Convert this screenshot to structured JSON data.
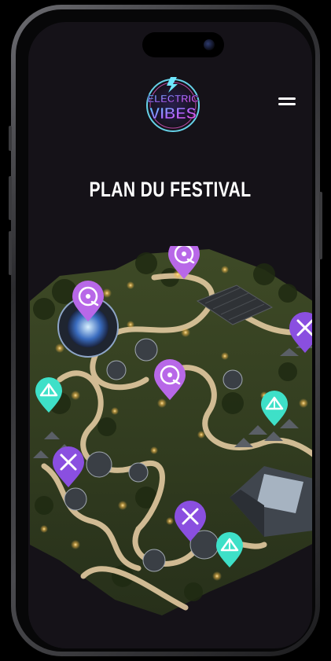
{
  "app": {
    "logo_line1": "ELECTRIC",
    "logo_line2": "VIBES"
  },
  "header": {
    "menu_icon": "hamburger-icon"
  },
  "page": {
    "title": "PLAN DU FESTIVAL"
  },
  "colors": {
    "background": "#151218",
    "stage_marker": "#b868e8",
    "food_marker": "#8a4fe0",
    "camping_marker": "#3ee0c8",
    "lights": "#f5c86a",
    "paths": "#e2c9a0"
  },
  "map": {
    "markers": [
      {
        "type": "stage",
        "icon": "vinyl-record-icon"
      },
      {
        "type": "stage",
        "icon": "vinyl-record-icon"
      },
      {
        "type": "stage",
        "icon": "vinyl-record-icon"
      },
      {
        "type": "food",
        "icon": "fork-knife-icon"
      },
      {
        "type": "food",
        "icon": "fork-knife-icon"
      },
      {
        "type": "food",
        "icon": "fork-knife-icon"
      },
      {
        "type": "camping",
        "icon": "tent-icon"
      },
      {
        "type": "camping",
        "icon": "tent-icon"
      },
      {
        "type": "camping",
        "icon": "tent-icon"
      }
    ]
  }
}
